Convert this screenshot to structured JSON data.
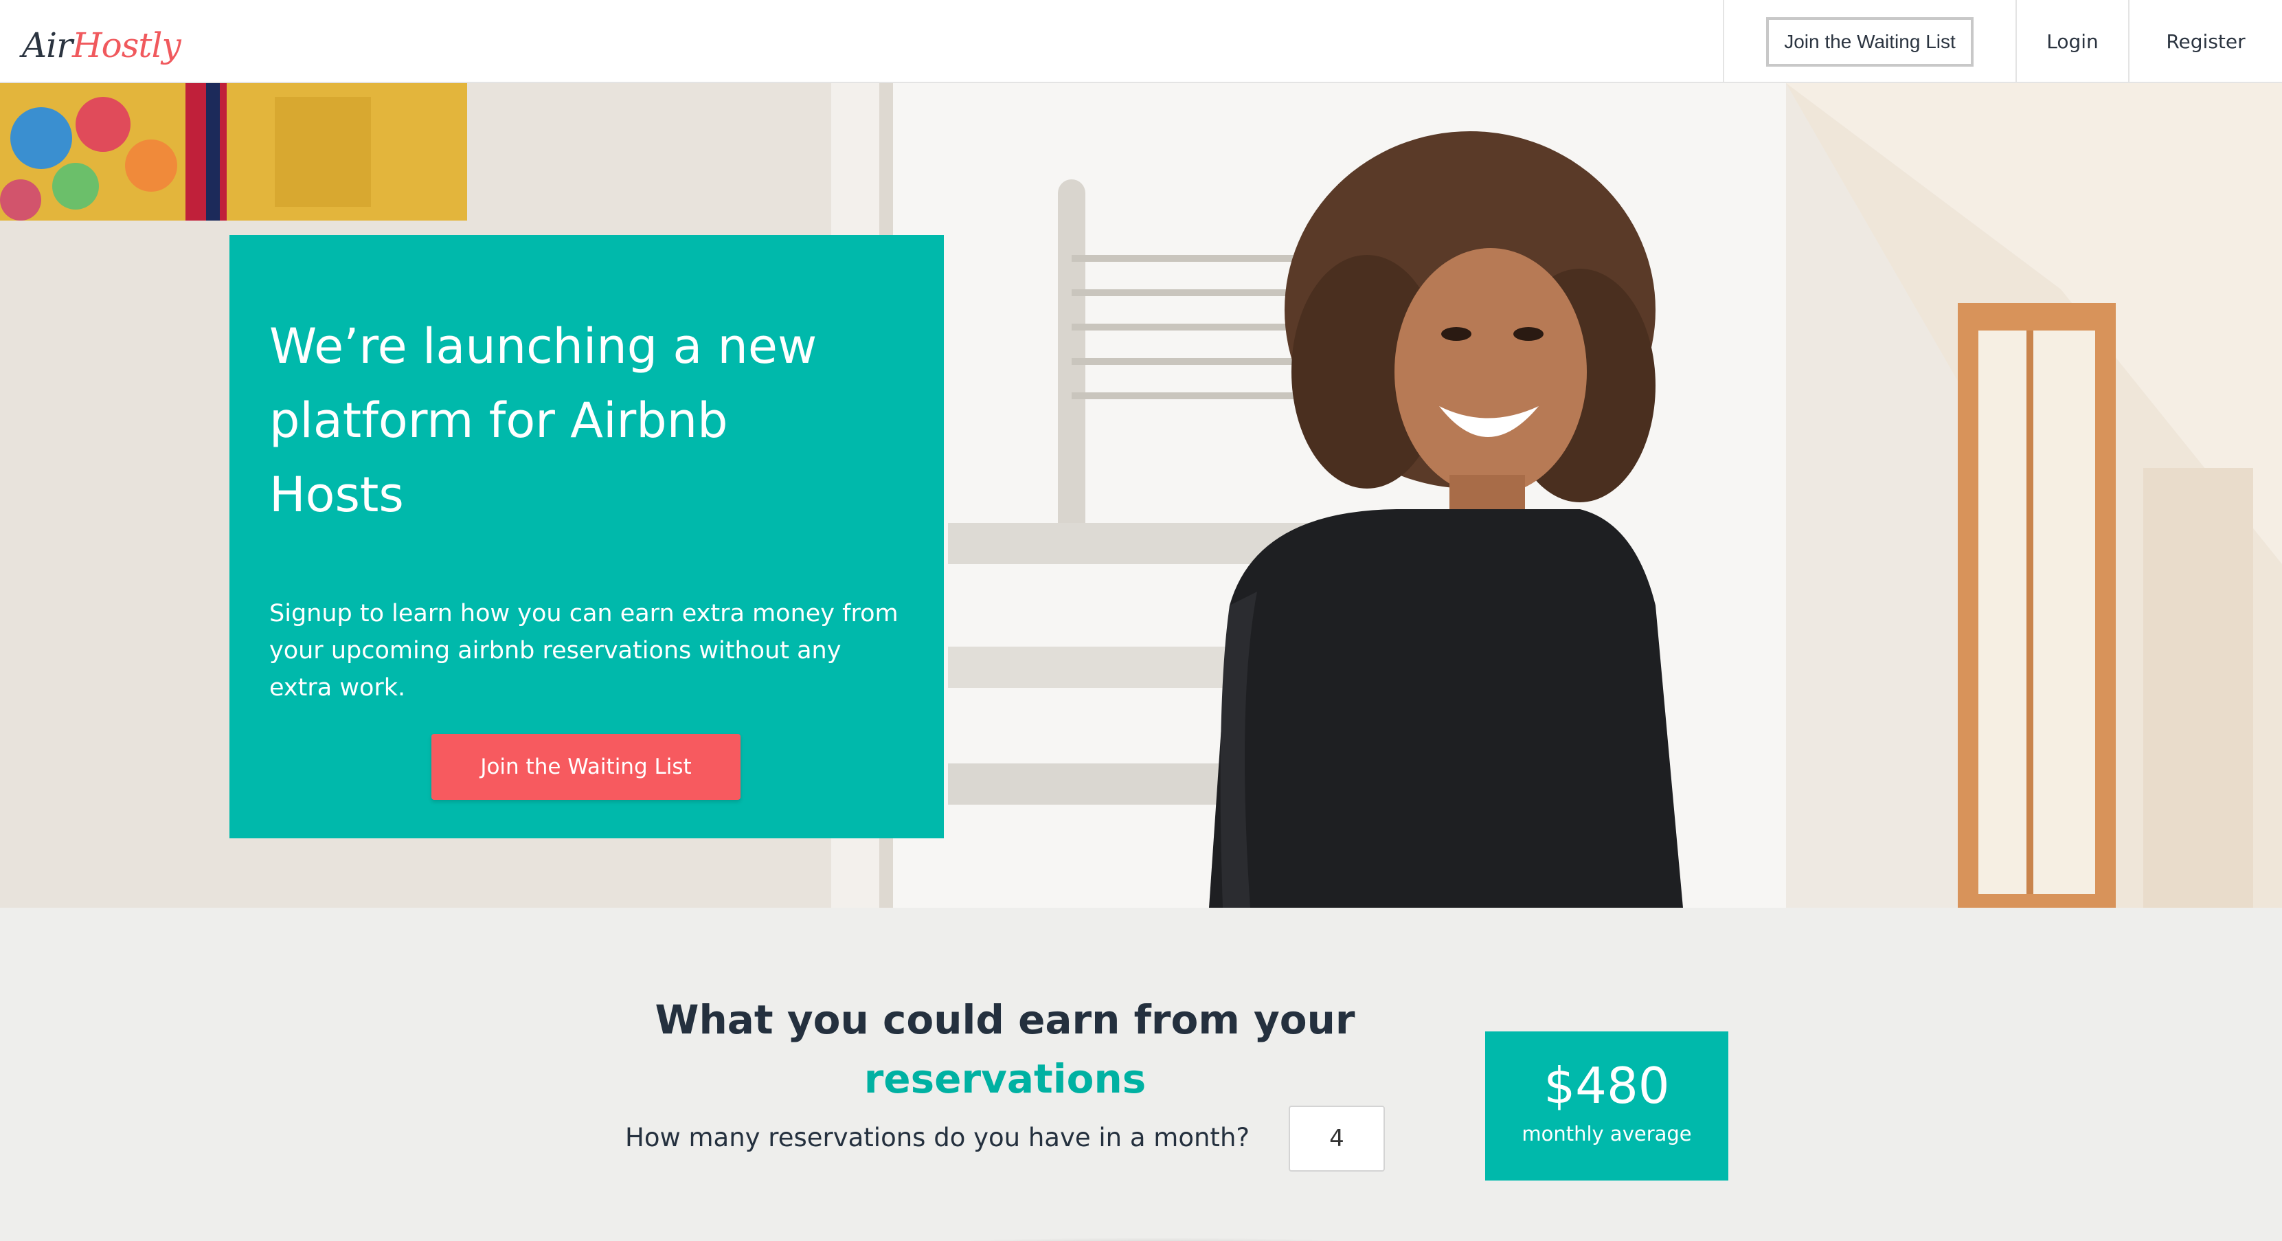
{
  "logo": {
    "part1": "Air",
    "part2": "Hostly"
  },
  "nav": {
    "waiting_list": "Join the Waiting List",
    "login": "Login",
    "register": "Register"
  },
  "hero": {
    "title_line1": "We’re launching a new",
    "title_line2": "platform for Airbnb",
    "title_line3": "Hosts",
    "subtitle": "Signup to learn how you can earn extra money from your upcoming airbnb reservations without any extra work.",
    "cta": "Join the Waiting List",
    "image_description": "smiling-woman-in-bright-room-photo"
  },
  "earnings": {
    "heading_part1": "What you could earn from your",
    "heading_part2": "reservations",
    "question": "How many reservations do you have in a month?",
    "input_value": "4",
    "amount": "$480",
    "amount_label": "monthly average"
  },
  "colors": {
    "teal": "#00b9ab",
    "coral": "#f75a5f",
    "dark_text": "#24303e",
    "section_bg": "#eeeeec"
  }
}
